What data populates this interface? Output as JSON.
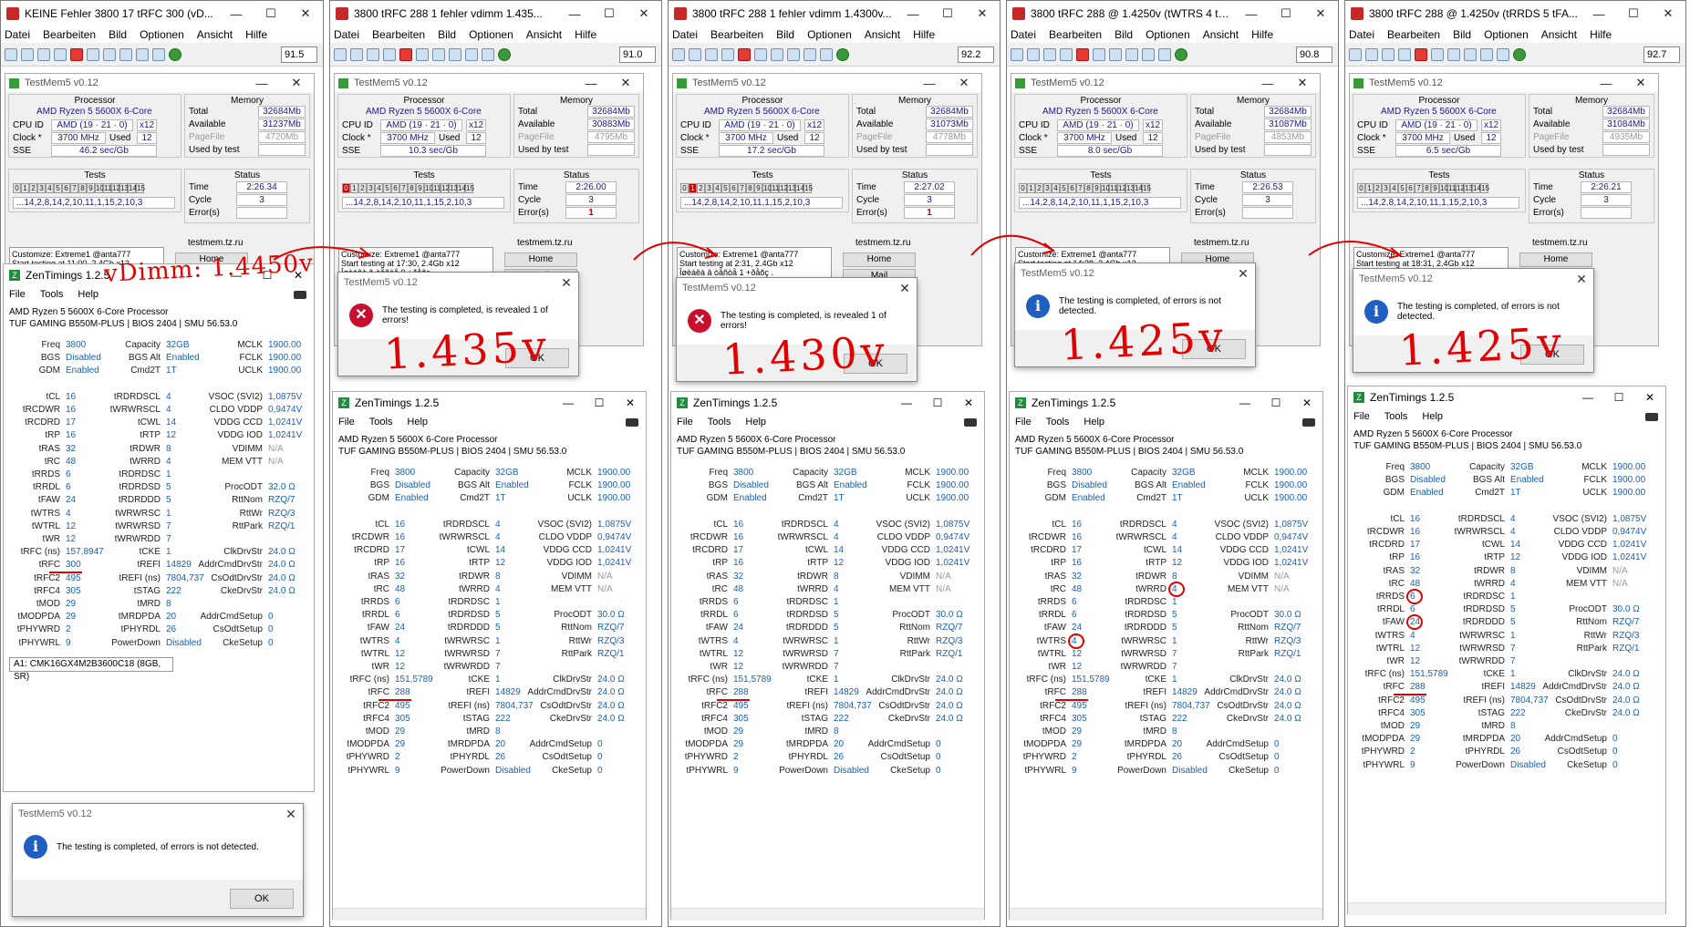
{
  "menu": [
    "Datei",
    "Bearbeiten",
    "Bild",
    "Optionen",
    "Ansicht",
    "Hilfe"
  ],
  "colors": {
    "accent_red": "#e00000",
    "value_blue": "#1c5fb4",
    "error_red": "#c40000"
  },
  "icons": [
    "app-icon",
    "open-icon",
    "save-icon",
    "delete-icon",
    "cut-icon",
    "copy-icon",
    "paste-icon",
    "undo-icon",
    "zoom-icon",
    "info-icon",
    "error-icon",
    "camera-icon"
  ],
  "testmem": {
    "title": "TestMem5 v0.12",
    "processor_label": "Processor",
    "memory_label": "Memory",
    "cpu_name": "AMD Ryzen 5 5600X 6-Core",
    "cpu_id_label": "CPU ID",
    "cpu_id": "AMD  (19 · 21 · 0)",
    "cpu_id_x": "x12",
    "clock_label": "Clock *",
    "clock": "3700 MHz",
    "used_label": "Used",
    "used": "12",
    "sse_label": "SSE",
    "total_label": "Total",
    "total": "32684Mb",
    "available_label": "Available",
    "pagefile_label": "PageFile",
    "used_by_test_label": "Used by test",
    "tests_label": "Tests",
    "status_label": "Status",
    "time_label": "Time",
    "cycle_label": "Cycle",
    "errors_label": "Error(s)",
    "cycle": "3",
    "sequence": "...14,2,8,14,2,10,11,1,15,2,10,3",
    "site": "testmem.tz.ru",
    "home": "Home",
    "mail": "Mail",
    "load_config": "Load config & exit",
    "test_numbers": [
      "0",
      "1",
      "2",
      "3",
      "4",
      "5",
      "6",
      "7",
      "8",
      "9",
      "10",
      "11",
      "12",
      "13",
      "14",
      "15"
    ]
  },
  "zen": {
    "title": "ZenTimings 1.2.5",
    "menu": [
      "File",
      "Tools",
      "Help"
    ],
    "cpu": "AMD Ryzen 5 5600X 6-Core Processor",
    "board": "TUF GAMING B550M-PLUS | BIOS 2404 | SMU 56.53.0",
    "col1": [
      [
        "Freq",
        "3800"
      ],
      [
        "BGS",
        "Disabled"
      ],
      [
        "GDM",
        "Enabled"
      ],
      [
        "",
        ""
      ],
      [
        "tCL",
        "16"
      ],
      [
        "tRCDWR",
        "16"
      ],
      [
        "tRCDRD",
        "17"
      ],
      [
        "tRP",
        "16"
      ],
      [
        "tRAS",
        "32"
      ],
      [
        "tRC",
        "48"
      ],
      [
        "tRRDS",
        "6"
      ],
      [
        "tRRDL",
        "6"
      ],
      [
        "tFAW",
        "24"
      ],
      [
        "tWTRS",
        "4"
      ],
      [
        "tWTRL",
        "12"
      ],
      [
        "tWR",
        "12"
      ],
      [
        "tRFC (ns)",
        "151,5789"
      ],
      [
        "tRFC",
        "288"
      ],
      [
        "tRFC2",
        "495"
      ],
      [
        "tRFC4",
        "305"
      ],
      [
        "tMOD",
        "29"
      ],
      [
        "tMODPDA",
        "29"
      ],
      [
        "tPHYWRD",
        "2"
      ],
      [
        "tPHYWRL",
        "9"
      ]
    ],
    "col2": [
      [
        "Capacity",
        "32GB"
      ],
      [
        "BGS Alt",
        "Enabled"
      ],
      [
        "Cmd2T",
        "1T"
      ],
      [
        "",
        ""
      ],
      [
        "tRDRDSCL",
        "4"
      ],
      [
        "tWRWRSCL",
        "4"
      ],
      [
        "tCWL",
        "14"
      ],
      [
        "tRTP",
        "12"
      ],
      [
        "tRDWR",
        "8"
      ],
      [
        "tWRRD",
        "4"
      ],
      [
        "tRDRDSC",
        "1"
      ],
      [
        "tRDRDSD",
        "5"
      ],
      [
        "tRDRDDD",
        "5"
      ],
      [
        "tWRWRSC",
        "1"
      ],
      [
        "tWRWRSD",
        "7"
      ],
      [
        "tWRWRDD",
        "7"
      ],
      [
        "tCKE",
        "1"
      ],
      [
        "tREFI",
        "14829"
      ],
      [
        "tREFI (ns)",
        "7804,737"
      ],
      [
        "tSTAG",
        "222"
      ],
      [
        "tMRD",
        "8"
      ],
      [
        "tMRDPDA",
        "20"
      ],
      [
        "tPHYRDL",
        "26"
      ],
      [
        "PowerDown",
        "Disabled"
      ]
    ],
    "col3": [
      [
        "MCLK",
        "1900.00"
      ],
      [
        "FCLK",
        "1900.00"
      ],
      [
        "UCLK",
        "1900.00"
      ],
      [
        "",
        ""
      ],
      [
        "VSOC (SVI2)",
        "1,0875V"
      ],
      [
        "CLDO VDDP",
        "0,9474V"
      ],
      [
        "VDDG CCD",
        "1,0241V"
      ],
      [
        "VDDG IOD",
        "1,0241V"
      ],
      [
        "VDIMM",
        "N/A"
      ],
      [
        "MEM VTT",
        "N/A"
      ],
      [
        "",
        ""
      ],
      [
        "ProcODT",
        "32.0 Ω"
      ],
      [
        "RttNom",
        "RZQ/7"
      ],
      [
        "RttWr",
        "RZQ/3"
      ],
      [
        "RttPark",
        "RZQ/1"
      ],
      [
        "",
        ""
      ],
      [
        "ClkDrvStr",
        "24.0 Ω"
      ],
      [
        "AddrCmdDrvStr",
        "24.0 Ω"
      ],
      [
        "CsOdtDrvStr",
        "24.0 Ω"
      ],
      [
        "CkeDrvStr",
        "24.0 Ω"
      ],
      [
        "",
        ""
      ],
      [
        "AddrCmdSetup",
        "0"
      ],
      [
        "CsOdtSetup",
        "0"
      ],
      [
        "CkeSetup",
        "0"
      ]
    ]
  },
  "panels": [
    {
      "window_title": "KEINE Fehler 3800 17 tRFC 300 (vD...",
      "zoom": "91.5",
      "available": "31237Mb",
      "pagefile": "4720Mb",
      "speed": "46.2 sec/Gb",
      "time": "2:26.34",
      "errors": "",
      "log": "Customize: Extreme1 @anta777\nStart testing at 11:00, 2.4Gb x12\nTesting completed in 2:26.34,\nno errors.",
      "dialog_title": "",
      "dialog_text": "",
      "voltage": "",
      "handwritten": "vDimm: 1.4450v",
      "trfc_ns": "157,8947",
      "trfc": "300",
      "dimm": "A1: CMK16GX4M2B3600C18 (8GB, SR)",
      "bottom_dialog_title": "TestMem5 v0.12",
      "bottom_dialog_text": "The testing is completed, of errors is not detected.",
      "ok": "OK"
    },
    {
      "window_title": "3800 tRFC 288 1 fehler vdimm 1.435...",
      "zoom": "91.0",
      "available": "30883Mb",
      "pagefile": "4795Mb",
      "speed": "10.3 sec/Gb",
      "time": "2:26.00",
      "errors": "1",
      "log": "Customize: Extreme1 @anta777\nStart testing at 17:30, 2.4Gb x12\nÎøèáêà â òåñòå 0 +ðåõç .\nTesting is completed through 2:26.00,\ndetected 1 error(s).",
      "dialog_title": "TestMem5 v0.12",
      "dialog_text": "The testing is completed, is revealed 1 of errors!",
      "voltage": "1.435v",
      "trfc_ns": "151,5789",
      "trfc": "288",
      "ok": "OK"
    },
    {
      "window_title": "3800 tRFC 288 1 fehler vdimm 1.4300v...",
      "zoom": "92.2",
      "available": "31073Mb",
      "pagefile": "4778Mb",
      "speed": "17.2 sec/Gb",
      "time": "2:27.02",
      "errors": "1",
      "log": "Customize: Extreme1 @anta777\nStart testing at 2:31, 2.4Gb x12\nÎøèáêà â òåñòå 1 +ðåõç .\nTesting is completed through 2:27.02,\ndetected 1 error(s).",
      "dialog_title": "TestMem5 v0.12",
      "dialog_text": "The testing is completed, is revealed 1 of errors!",
      "voltage": "1.430v",
      "trfc_ns": "151,5789",
      "trfc": "288",
      "ok": "OK"
    },
    {
      "window_title": "3800 tRFC 288 @ 1.4250v (tWTRS 4 tW...",
      "zoom": "90.8",
      "available": "31087Mb",
      "pagefile": "4853Mb",
      "speed": "8.0 sec/Gb",
      "time": "2:26.53",
      "errors": "",
      "log": "Customize: Extreme1 @anta777\nStart testing at 14:28, 2.4Gb x12\nTesting completed in 2:26.53,\nno errors.",
      "dialog_title": "TestMem5 v0.12",
      "dialog_text": "The testing is completed, of errors is not detected.",
      "voltage": "1.425v",
      "trfc_ns": "151,5789",
      "trfc": "288",
      "ok": "OK"
    },
    {
      "window_title": "3800 tRFC 288 @ 1.4250v (tRRDS 5 tFA...",
      "zoom": "92.7",
      "available": "31084Mb",
      "pagefile": "4935Mb",
      "speed": "6.5 sec/Gb",
      "time": "2:26.21",
      "errors": "",
      "log": "Customize: Extreme1 @anta777\nStart testing at 18:31, 2.4Gb x12\nTesting completed in 2:26.21,\nno errors.",
      "dialog_title": "TestMem5 v0.12",
      "dialog_text": "The testing is completed, of errors is not detected.",
      "voltage": "1.425v",
      "trfc_ns": "151,5789",
      "trfc": "288",
      "ok": "OK"
    }
  ]
}
